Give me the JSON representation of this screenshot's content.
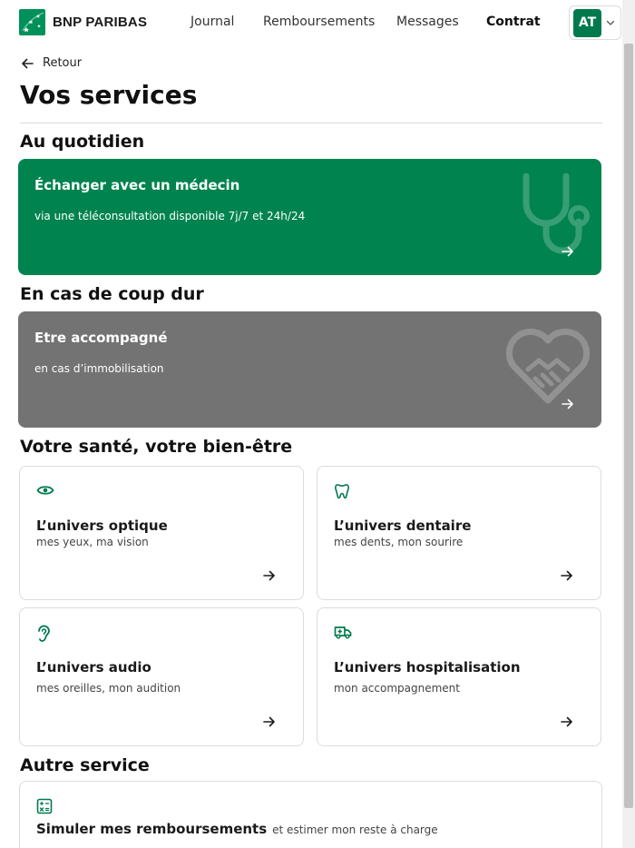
{
  "header": {
    "brand": "BNP PARIBAS",
    "nav": [
      {
        "label": "Journal"
      },
      {
        "label": "Remboursements"
      },
      {
        "label": "Messages"
      },
      {
        "label": "Contrat"
      }
    ],
    "avatar_initials": "AT"
  },
  "back_label": "Retour",
  "page_title": "Vos services",
  "sections": {
    "daily": {
      "title": "Au quotidien",
      "card": {
        "title": "Échanger avec un médecin",
        "subtitle": "via une téléconsultation disponible 7j/7 et 24h/24",
        "icon": "stethoscope-icon"
      }
    },
    "hard_times": {
      "title": "En cas de coup dur",
      "card": {
        "title": "Etre accompagné",
        "subtitle": "en cas d’immobilisation",
        "icon": "heart-handshake-icon"
      }
    },
    "health": {
      "title": "Votre santé, votre bien-être",
      "cards": [
        {
          "title": "L’univers optique",
          "subtitle": "mes yeux, ma vision",
          "icon": "eye-icon"
        },
        {
          "title": "L’univers dentaire",
          "subtitle": "mes dents, mon sourire",
          "icon": "tooth-icon"
        },
        {
          "title": "L’univers audio",
          "subtitle": "mes oreilles, mon audition",
          "icon": "ear-icon"
        },
        {
          "title": "L’univers hospitalisation",
          "subtitle": "mon accompagnement",
          "icon": "ambulance-icon"
        }
      ]
    },
    "other": {
      "title": "Autre service",
      "card": {
        "title": "Simuler mes remboursements",
        "subtitle": "et estimer mon reste à charge",
        "icon": "calculator-icon"
      }
    }
  },
  "colors": {
    "brand_green": "#00834f",
    "grey_card": "#737373",
    "accent_green": "#007a4d"
  }
}
